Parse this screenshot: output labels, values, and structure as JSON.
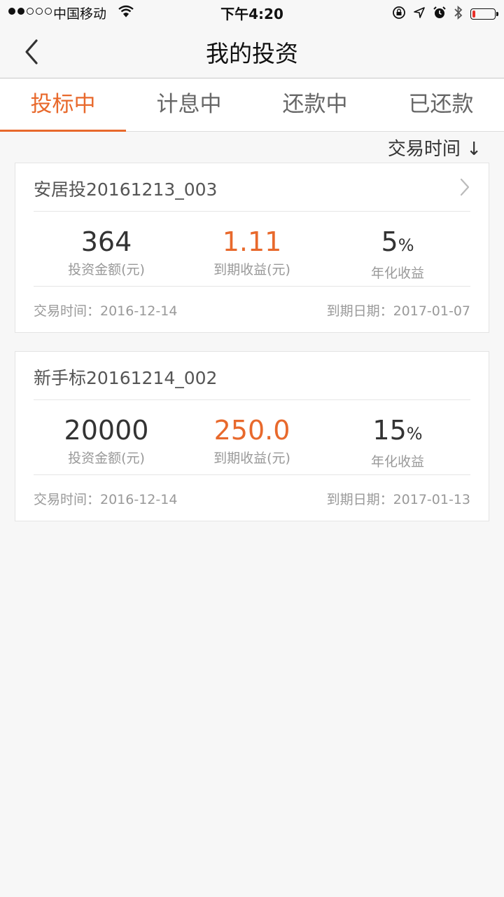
{
  "status_bar": {
    "carrier": "中国移动",
    "time": "下午4:20",
    "battery_level": 0.15,
    "battery_color": "#e8302a"
  },
  "nav": {
    "title": "我的投资",
    "back_icon": "chevron-left-icon"
  },
  "tabs": [
    {
      "label": "投标中",
      "active": true
    },
    {
      "label": "计息中",
      "active": false
    },
    {
      "label": "还款中",
      "active": false
    },
    {
      "label": "已还款",
      "active": false
    }
  ],
  "accent_color": "#e8692c",
  "sort": {
    "label": "交易时间",
    "arrow": "↓"
  },
  "investments": [
    {
      "name": "安居投20161213_003",
      "amount": "364",
      "amount_label": "投资金额(元)",
      "income": "1.11",
      "income_label": "到期收益(元)",
      "rate": "5",
      "rate_unit": "%",
      "rate_label": "年化收益",
      "trade_date": "交易时间：2016-12-14",
      "due_date": "到期日期：2017-01-07"
    },
    {
      "name": "新手标20161214_002",
      "amount": "20000",
      "amount_label": "投资金额(元)",
      "income": "250.0",
      "income_label": "到期收益(元)",
      "rate": "15",
      "rate_unit": "%",
      "rate_label": "年化收益",
      "trade_date": "交易时间：2016-12-14",
      "due_date": "到期日期：2017-01-13"
    }
  ]
}
